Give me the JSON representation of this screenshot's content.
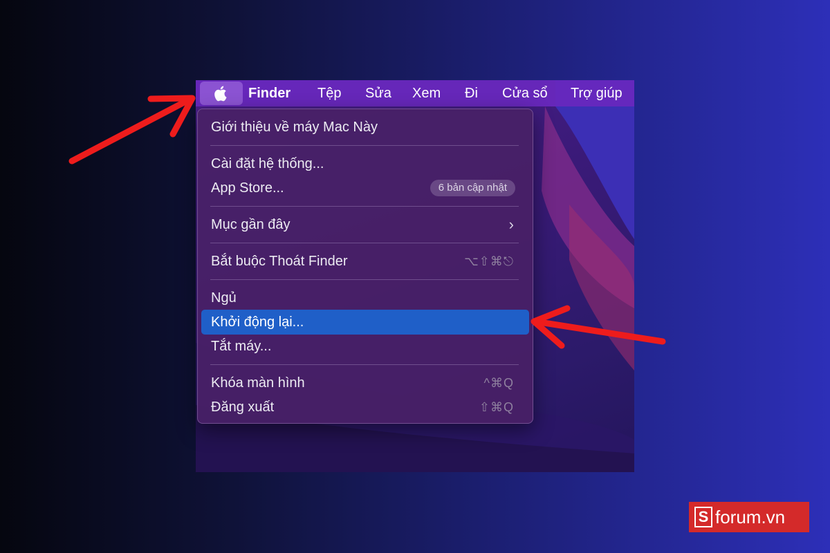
{
  "menubar": {
    "app_name": "Finder",
    "items": [
      "Tệp",
      "Sửa",
      "Xem",
      "Đi",
      "Cửa sổ",
      "Trợ giúp"
    ],
    "apple_icon": "apple-icon"
  },
  "apple_menu": {
    "about": "Giới thiệu về máy Mac Này",
    "system_settings": "Cài đặt hệ thống...",
    "app_store": "App Store...",
    "app_store_badge": "6 bản cập nhật",
    "recent_items": "Mục gần đây",
    "force_quit": "Bắt buộc Thoát Finder",
    "force_quit_shortcut": "⌥⇧⌘⎋",
    "sleep": "Ngủ",
    "restart": "Khởi động lại...",
    "shut_down": "Tắt máy...",
    "lock_screen": "Khóa màn hình",
    "lock_screen_shortcut": "^⌘Q",
    "log_out": "Đăng xuất",
    "log_out_shortcut": "⇧⌘Q"
  },
  "watermark": {
    "logo_letter": "S",
    "text": "forum.vn"
  },
  "colors": {
    "highlight": "#1f5fc8",
    "menubar": "#6928be",
    "arrow": "#ee1c1c",
    "logo_bg": "#d42a2a"
  }
}
